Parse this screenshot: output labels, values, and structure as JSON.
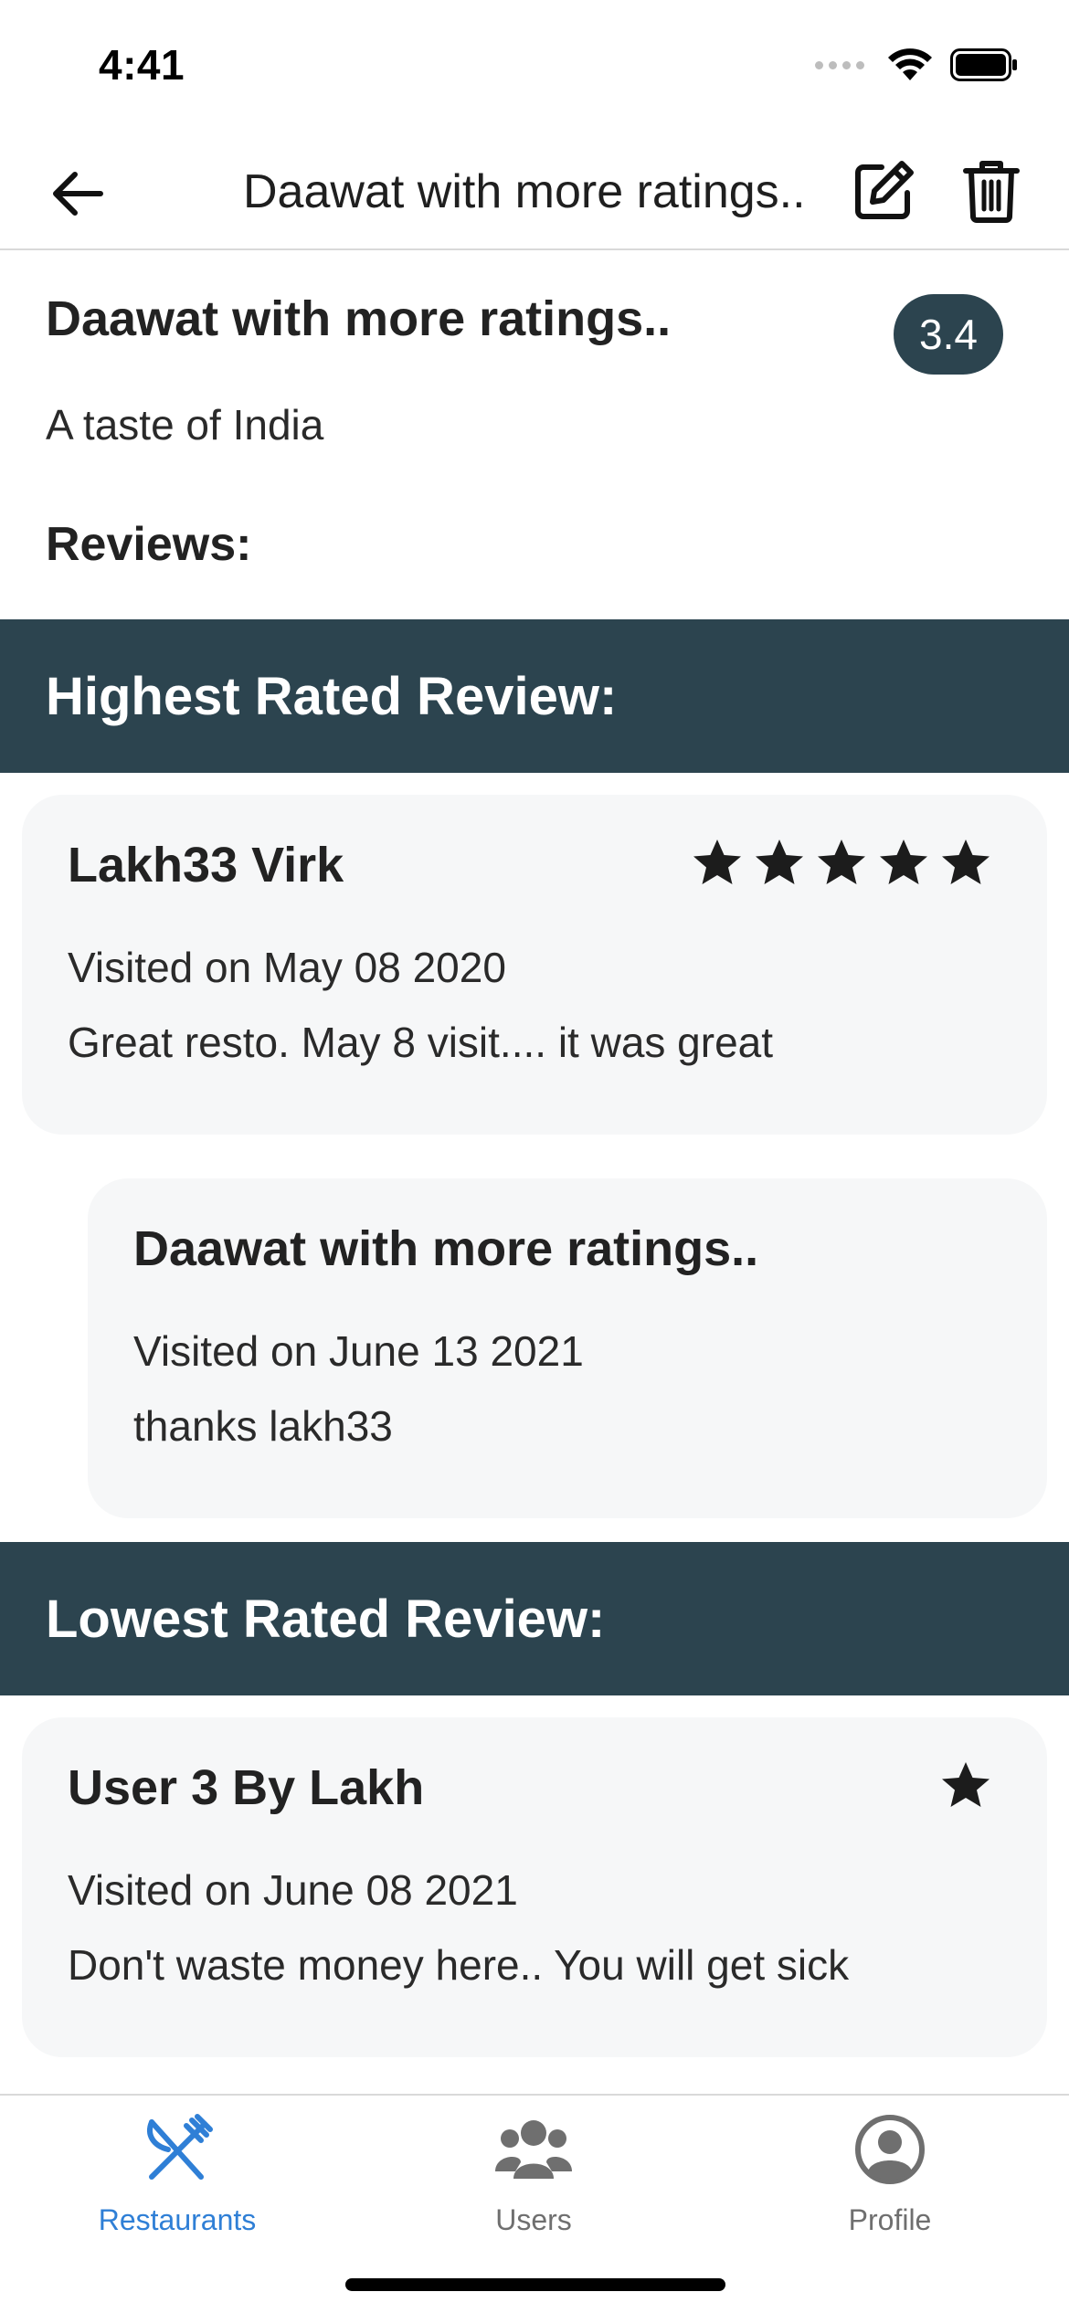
{
  "status_bar": {
    "time": "4:41"
  },
  "header": {
    "title": "Daawat with more ratings.."
  },
  "restaurant": {
    "name": "Daawat with more ratings..",
    "rating": "3.4",
    "description": "A taste of India",
    "reviews_label": "Reviews:"
  },
  "highest": {
    "section_title": "Highest Rated Review:",
    "review": {
      "author": "Lakh33 Virk",
      "stars": 5,
      "visited": "Visited on May 08 2020",
      "text": "Great resto. May 8 visit.... it was great"
    },
    "reply": {
      "author": "Daawat with more ratings..",
      "visited": "Visited on June 13 2021",
      "text": "thanks lakh33"
    }
  },
  "lowest": {
    "section_title": "Lowest Rated Review:",
    "review": {
      "author": "User 3 By Lakh",
      "stars": 1,
      "visited": "Visited on June 08 2021",
      "text": "Don't waste money here.. You will get sick"
    }
  },
  "tabs": [
    {
      "label": "Restaurants",
      "icon": "utensils-icon",
      "active": true
    },
    {
      "label": "Users",
      "icon": "users-icon",
      "active": false
    },
    {
      "label": "Profile",
      "icon": "user-circle-icon",
      "active": false
    }
  ],
  "colors": {
    "accent": "#2c444f",
    "tab_active": "#2f7fd6",
    "tab_inactive": "#6f6f6f",
    "card_bg": "#f6f7f8"
  }
}
